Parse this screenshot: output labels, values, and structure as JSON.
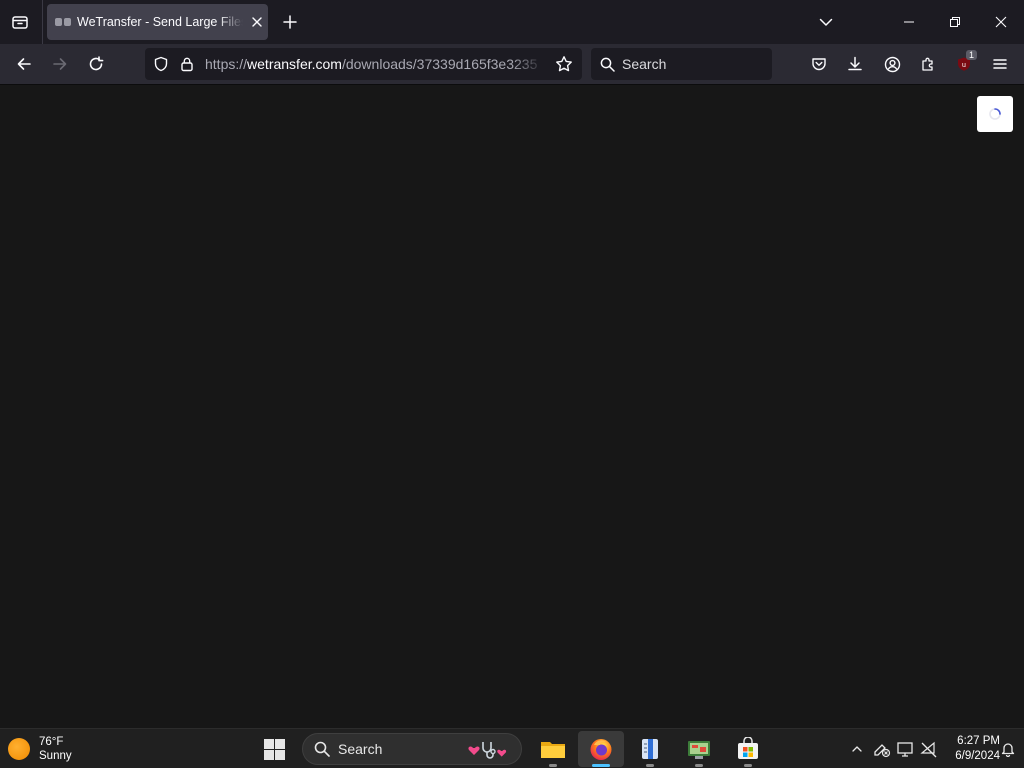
{
  "browser": {
    "tab": {
      "title": "WeTransfer - Send Large Files & Share Photos Online"
    },
    "url": {
      "scheme": "https://",
      "domain": "wetransfer.com",
      "path": "/downloads/37339d165f3e3235"
    },
    "search": {
      "placeholder": "Search"
    },
    "extension_badge": "1"
  },
  "taskbar": {
    "weather": {
      "temp": "76°F",
      "condition": "Sunny"
    },
    "search_label": "Search",
    "clock": {
      "time": "6:27 PM",
      "date": "6/9/2024"
    }
  },
  "colors": {
    "chrome_bg": "#1c1b22",
    "toolbar_bg": "#2b2a33",
    "content_bg": "#171717",
    "taskbar_bg": "#202020",
    "accent": "#4cc2ff"
  }
}
